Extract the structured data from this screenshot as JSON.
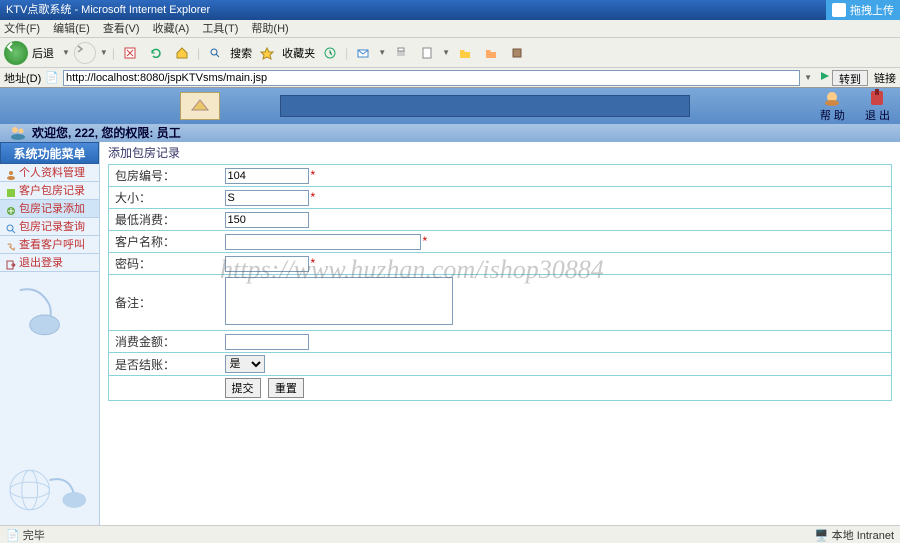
{
  "ie": {
    "title": "KTV点歌系统 - Microsoft Internet Explorer",
    "menus": [
      "文件(F)",
      "编辑(E)",
      "查看(V)",
      "收藏(A)",
      "工具(T)",
      "帮助(H)"
    ],
    "back_label": "后退",
    "search_label": "搜索",
    "fav_label": "收藏夹",
    "addr_label": "地址(D)",
    "url": "http://localhost:8080/jspKTVsms/main.jsp",
    "go_label": "转到",
    "links_label": "链接"
  },
  "badge": {
    "text": "拖拽上传"
  },
  "banner": {
    "help": "帮 助",
    "exit": "退 出"
  },
  "welcome": {
    "text": "欢迎您, 222, 您的权限: 员工"
  },
  "sidebar": {
    "header": "系统功能菜单",
    "items": [
      {
        "label": "个人资料管理"
      },
      {
        "label": "客户包房记录"
      },
      {
        "label": "包房记录添加"
      },
      {
        "label": "包房记录查询"
      },
      {
        "label": "查看客户呼叫"
      },
      {
        "label": "退出登录"
      }
    ]
  },
  "form": {
    "title": "添加包房记录",
    "fields": {
      "room_no": {
        "label": "包房编号：",
        "value": "104",
        "req": "*"
      },
      "size": {
        "label": "大小：",
        "value": "S",
        "req": "*"
      },
      "min_cost": {
        "label": "最低消费：",
        "value": "150"
      },
      "cust_name": {
        "label": "客户名称：",
        "value": "",
        "req": "*"
      },
      "password": {
        "label": "密码：",
        "value": "",
        "req": "*"
      },
      "remark": {
        "label": "备注：",
        "value": ""
      },
      "amount": {
        "label": "消费金额：",
        "value": ""
      },
      "settled": {
        "label": "是否结账：",
        "value": "是"
      }
    },
    "submit": "提交",
    "reset": "重置"
  },
  "status": {
    "done": "完毕",
    "zone": "本地 Intranet"
  },
  "watermark": "https://www.huzhan.com/ishop30884"
}
